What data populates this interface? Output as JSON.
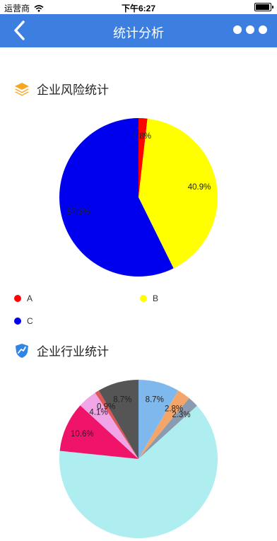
{
  "status_bar": {
    "carrier": "运营商",
    "time": "下午6:27"
  },
  "nav": {
    "title": "统计分析"
  },
  "sections": {
    "risk_title": "企业风险统计",
    "industry_title": "企业行业统计"
  },
  "chart_data": [
    {
      "type": "pie",
      "title": "企业风险统计",
      "slices": [
        {
          "label": "A",
          "value": 1.8,
          "text": "1.8%",
          "color": "#ff0000"
        },
        {
          "label": "B",
          "value": 40.9,
          "text": "40.9%",
          "color": "#ffff00"
        },
        {
          "label": "C",
          "value": 57.3,
          "text": "57.3%",
          "color": "#0000ee"
        }
      ],
      "legend": [
        "A",
        "B",
        "C"
      ]
    },
    {
      "type": "pie",
      "title": "企业行业统计",
      "slices": [
        {
          "value": 8.7,
          "text": "8.7%",
          "color": "#7fb8ec"
        },
        {
          "value": 2.8,
          "text": "2.8%",
          "color": "#f4a66a"
        },
        {
          "value": 2.3,
          "text": "2.3%",
          "color": "#8a9bb0"
        },
        {
          "value": 65.9,
          "text": "",
          "color": "#aeeef0"
        },
        {
          "value": 10.6,
          "text": "10.6%",
          "color": "#f0136a"
        },
        {
          "value": 4.1,
          "text": "4.1%",
          "color": "#f0a6e6"
        },
        {
          "value": 0.9,
          "text": "0.9%",
          "color": "#e05555"
        },
        {
          "value": 8.7,
          "text": "8.7%",
          "color": "#555555"
        }
      ]
    }
  ]
}
